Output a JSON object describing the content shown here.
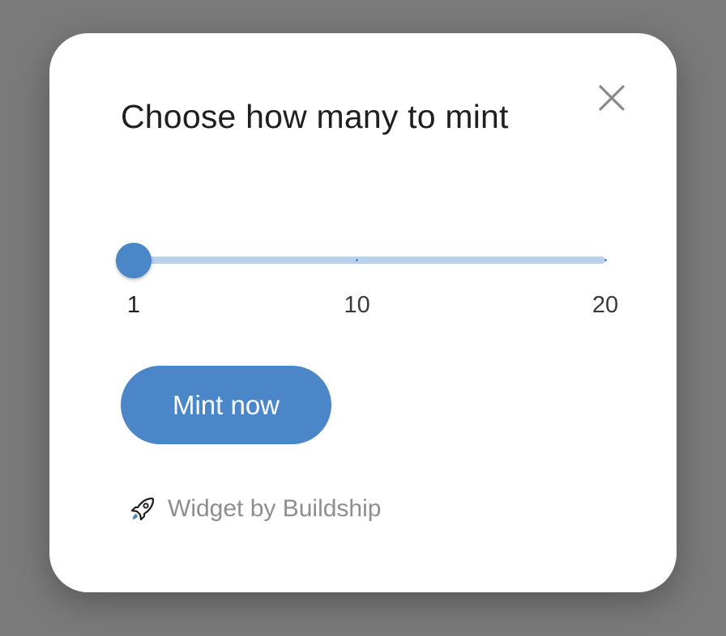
{
  "dialog": {
    "title": "Choose how many to mint",
    "close_icon": "close-icon"
  },
  "slider": {
    "min": 1,
    "max": 20,
    "value": 1,
    "ticks": [
      {
        "value": 1,
        "label": "1"
      },
      {
        "value": 10,
        "label": "10"
      },
      {
        "value": 20,
        "label": "20"
      }
    ]
  },
  "actions": {
    "mint_label": "Mint now"
  },
  "footer": {
    "icon": "rocket-icon",
    "text": "Widget by Buildship"
  },
  "colors": {
    "accent": "#4a86c8",
    "track": "#b8d1ec",
    "backdrop": "#7a7a7a",
    "title": "#1f1f1f",
    "muted": "#8e8e8e"
  }
}
